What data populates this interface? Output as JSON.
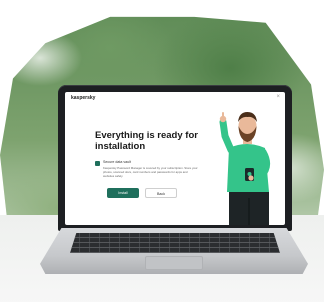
{
  "app": {
    "brand": "kaspersky",
    "close_glyph": "×"
  },
  "dialog": {
    "heading": "Everything is ready for installation",
    "checkbox": {
      "label": "Secure data vault",
      "checked": true,
      "description": "Kaspersky Password Manager is covered by your subscription. Store your photos, scanned docs, card numbers and passwords for apps and websites safely."
    },
    "primary_button": "Install",
    "secondary_button": "Back"
  },
  "colors": {
    "accent": "#1f6f5c",
    "shirt": "#34c48a"
  },
  "icons": {
    "close": "close-icon",
    "check": "check-icon"
  }
}
